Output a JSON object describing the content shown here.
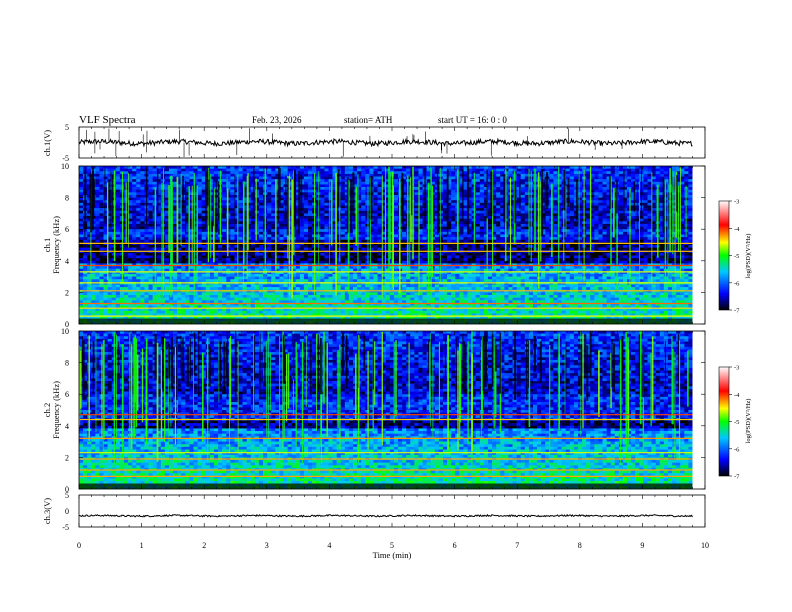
{
  "header": {
    "title": "VLF  Spectra",
    "date": "Feb. 23, 2026",
    "station": "station= ATH",
    "start": "start  UT  =    16: 0   : 0"
  },
  "chart_data": [
    {
      "type": "line",
      "panel": "ch1-waveform",
      "ylabel": "ch.1(V)",
      "ylim": [
        -5,
        5
      ],
      "yticks": [
        "5",
        "-5"
      ],
      "xlim": [
        0,
        10
      ],
      "x_range_of_trace": [
        0,
        9.8
      ],
      "approx_level": 0,
      "series": [
        {
          "values": "noisy trace near 0 V with occasional spikes"
        }
      ]
    },
    {
      "type": "heatmap",
      "panel": "ch1-spectrogram",
      "ylabel": "ch.1\nFrequency (kHz)",
      "ylim": [
        0,
        10
      ],
      "yticks": [
        "0",
        "2",
        "4",
        "6",
        "8",
        "10"
      ],
      "xlim": [
        0,
        10
      ],
      "x_range_of_data": [
        0,
        9.8
      ],
      "colorbar": {
        "label": "log(PSD)(V²/Hz)",
        "range": [
          -7,
          -3
        ],
        "ticks": [
          "-3",
          "-4",
          "-5",
          "-6",
          "-7"
        ],
        "colormap": [
          "#000000",
          "#0000ff",
          "#00ffff",
          "#00ff00",
          "#ffff00",
          "#ff0000",
          "#ffffff"
        ]
      },
      "features": {
        "strong_lines_khz": [
          0.5,
          1.0,
          1.3,
          2.1,
          2.6,
          3.3,
          3.7,
          4.6,
          5.1
        ],
        "dark_band_khz": [
          3.8,
          5.3
        ]
      }
    },
    {
      "type": "heatmap",
      "panel": "ch2-spectrogram",
      "ylabel": "ch.2\nFrequency (kHz)",
      "ylim": [
        0,
        10
      ],
      "yticks": [
        "0",
        "2",
        "4",
        "6",
        "8",
        "10"
      ],
      "xlim": [
        0,
        10
      ],
      "x_range_of_data": [
        0,
        9.8
      ],
      "colorbar": {
        "label": "log(PSD)(V²/Hz)",
        "range": [
          -7,
          -3
        ],
        "ticks": [
          "-3",
          "-4",
          "-5",
          "-6",
          "-7"
        ],
        "colormap": [
          "#000000",
          "#0000ff",
          "#00ffff",
          "#00ff00",
          "#ffff00",
          "#ff0000",
          "#ffffff"
        ]
      },
      "features": {
        "strong_lines_khz": [
          0.8,
          1.2,
          1.9,
          2.3,
          3.2,
          4.4,
          4.7
        ],
        "dark_band_khz": [
          3.9,
          4.3
        ]
      }
    },
    {
      "type": "line",
      "panel": "ch3-waveform",
      "ylabel": "ch.3(V)",
      "ylim": [
        -5,
        5
      ],
      "yticks": [
        "5",
        "0",
        "-5"
      ],
      "xlim": [
        0,
        10
      ],
      "x_range_of_trace": [
        0,
        9.8
      ],
      "approx_level": -1.5,
      "series": [
        {
          "values": "flat trace near -1.5 V"
        }
      ]
    }
  ],
  "xaxis": {
    "label": "Time  (min)",
    "ticks": [
      "0",
      "1",
      "2",
      "3",
      "4",
      "5",
      "6",
      "7",
      "8",
      "9",
      "10"
    ]
  }
}
